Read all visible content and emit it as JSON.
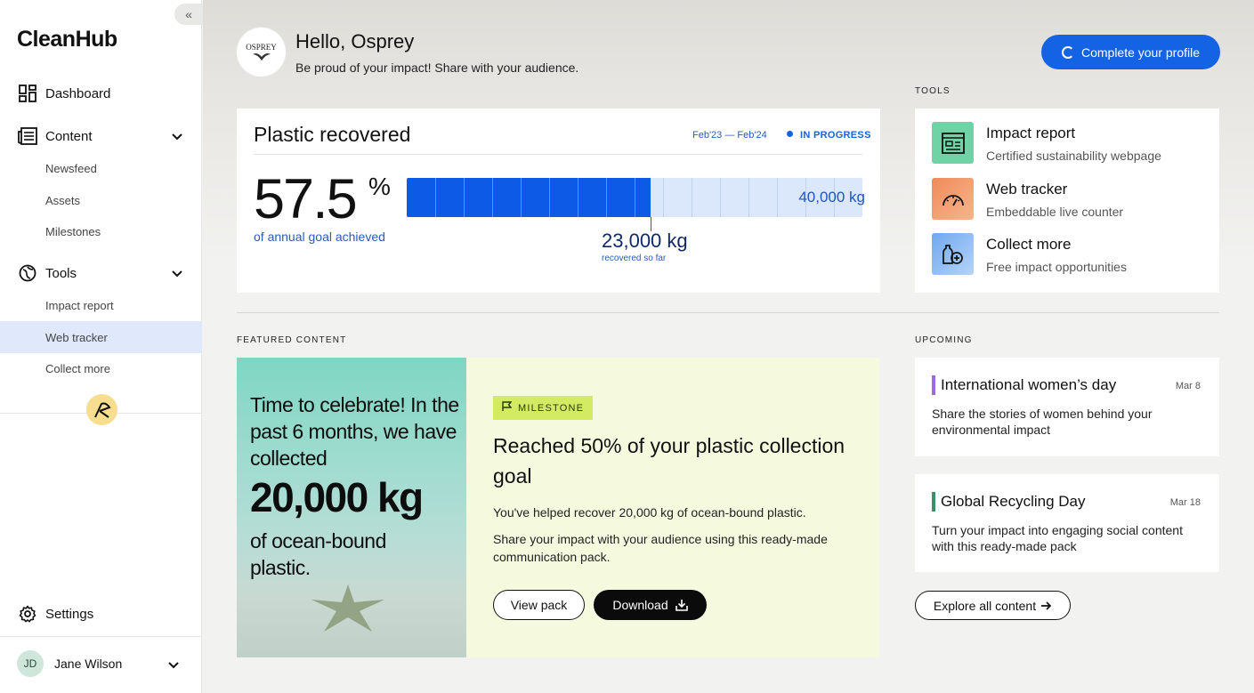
{
  "sidebar": {
    "logo": "CleanHub",
    "collapse_icon": "«",
    "nav": [
      {
        "label": "Dashboard",
        "icon": "dashboard-icon"
      },
      {
        "label": "Content",
        "icon": "content-icon"
      },
      {
        "label": "Tools",
        "icon": "tools-icon"
      }
    ],
    "content_sub": [
      "Newsfeed",
      "Assets",
      "Milestones"
    ],
    "tools_sub": [
      "Impact report",
      "Web tracker",
      "Collect more"
    ],
    "active_sub": "Web tracker",
    "settings_label": "Settings",
    "user": {
      "initials": "JD",
      "name": "Jane Wilson"
    }
  },
  "header": {
    "brand_logo_text": "OSPREY",
    "greeting": "Hello, Osprey",
    "subtitle": "Be proud of your impact! Share with your audience.",
    "profile_button": "Complete your profile"
  },
  "plastic": {
    "title": "Plastic recovered",
    "date_range": "Feb'23 — Feb'24",
    "status": "IN PROGRESS",
    "percent": "57.5",
    "percent_sign": "%",
    "caption": "of annual goal achieved",
    "goal_label": "40,000 kg",
    "recovered_label": "23,000 kg",
    "recovered_caption": "recovered so far",
    "progress_fraction": 0.535
  },
  "tools": {
    "section_label": "TOOLS",
    "items": [
      {
        "name": "Impact report",
        "desc": "Certified sustainability webpage",
        "icon": "report-icon",
        "color": "#6fd3a6"
      },
      {
        "name": "Web tracker",
        "desc": "Embeddable live counter",
        "icon": "gauge-icon",
        "color": "#f4a070"
      },
      {
        "name": "Collect more",
        "desc": "Free impact opportunities",
        "icon": "bottle-plus-icon",
        "color": "#8fbff2"
      }
    ]
  },
  "featured": {
    "section_label": "FEATURED CONTENT",
    "image_line1": "Time to celebrate! In the past 6 months, we have collected",
    "image_big": "20,000 kg",
    "image_line2": "of ocean-bound plastic.",
    "tag": "MILESTONE",
    "title": "Reached 50% of your plastic collection goal",
    "p1": "You've helped recover 20,000 kg of ocean-bound plastic.",
    "p2": "Share your impact with your audience using this ready-made communication pack.",
    "view_button": "View pack",
    "download_button": "Download"
  },
  "upcoming": {
    "section_label": "UPCOMING",
    "items": [
      {
        "title": "International women’s day",
        "date": "Mar 8",
        "desc": "Share the stories of women behind your environmental impact",
        "color": "#9b6be0"
      },
      {
        "title": "Global Recycling Day",
        "date": "Mar 18",
        "desc": "Turn your impact into engaging social content with this ready-made pack",
        "color": "#3f8f6a"
      }
    ],
    "explore_button": "Explore all content"
  }
}
